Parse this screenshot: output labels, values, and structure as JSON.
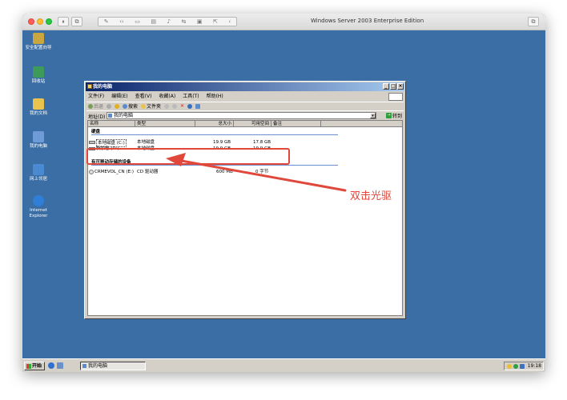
{
  "host": {
    "title": "Windows Server 2003 Enterprise Edition"
  },
  "desktop_icons": [
    {
      "label": "安全配置向导",
      "color": "#c9a640"
    },
    {
      "label": "回收站",
      "color": "#3c9a5a"
    },
    {
      "label": "我的文档",
      "color": "#e8c44e"
    },
    {
      "label": "我的电脑",
      "color": "#6f9bd8"
    },
    {
      "label": "网上邻居",
      "color": "#4a8ad0"
    },
    {
      "label": "Internet Explorer",
      "color": "#2f7fd8"
    }
  ],
  "explorer": {
    "title": "我的电脑",
    "menu": [
      "文件(F)",
      "编辑(E)",
      "查看(V)",
      "收藏(A)",
      "工具(T)",
      "帮助(H)"
    ],
    "toolbar": {
      "back": "后退",
      "search": "搜索",
      "folders": "文件夹"
    },
    "address_label": "地址(D)",
    "address_value": "我的电脑",
    "go_label": "转到",
    "columns": [
      "名称",
      "类型",
      "总大小",
      "可用空间",
      "备注"
    ],
    "groups": {
      "hard_disks": "硬盘",
      "removable": "有可移动存储的设备"
    },
    "drives": [
      {
        "name": "本地磁盘 (C:)",
        "type": "本地磁盘",
        "total": "19.9 GB",
        "free": "17.8 GB"
      },
      {
        "name": "新加卷 (D:)",
        "type": "本地磁盘",
        "total": "19.9 GB",
        "free": "19.9 GB"
      }
    ],
    "cd": {
      "name": "CRMEVOL_CN (E:)",
      "type": "CD 驱动器",
      "total": "600 MB",
      "free": "0 字节"
    }
  },
  "annotation": {
    "text": "双击光驱",
    "color": "#e0483c"
  },
  "taskbar": {
    "start": "开始",
    "task": "我的电脑",
    "clock": "19:18"
  }
}
